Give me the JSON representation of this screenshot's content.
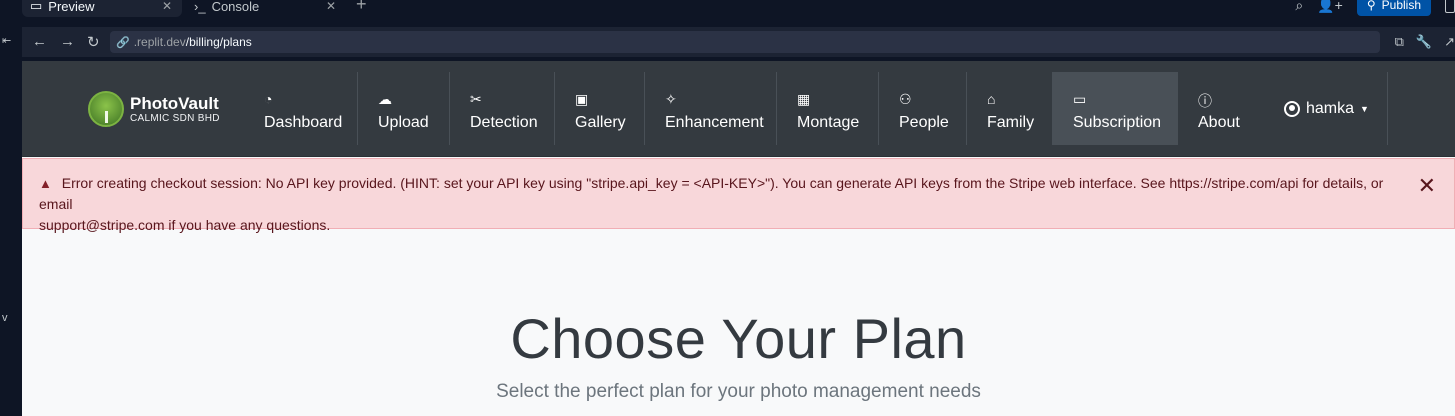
{
  "ide": {
    "tabs": [
      {
        "label": "Preview",
        "icon": "monitor-icon"
      },
      {
        "label": "Console",
        "icon": "terminal-icon"
      }
    ],
    "publish_label": "Publish"
  },
  "address": {
    "domain": ".replit.dev",
    "path": "/billing/plans"
  },
  "brand": {
    "name": "PhotoVault",
    "subtitle": "CALMIC SDN BHD"
  },
  "nav": {
    "items": [
      {
        "label": "Dashboard",
        "icon": "speedometer-icon"
      },
      {
        "label": "Upload",
        "icon": "cloud-upload-icon"
      },
      {
        "label": "Detection",
        "icon": "scissors-icon"
      },
      {
        "label": "Gallery",
        "icon": "image-icon"
      },
      {
        "label": "Enhancement",
        "icon": "magic-wand-icon"
      },
      {
        "label": "Montage",
        "icon": "grid-icon"
      },
      {
        "label": "People",
        "icon": "people-icon"
      },
      {
        "label": "Family",
        "icon": "house-heart-icon"
      },
      {
        "label": "Subscription",
        "icon": "credit-card-icon"
      },
      {
        "label": "About",
        "icon": "info-circle-icon"
      }
    ],
    "active": "Subscription",
    "user": "hamka"
  },
  "alert": {
    "line1": "Error creating checkout session: No API key provided. (HINT: set your API key using \"stripe.api_key = <API-KEY>\"). You can generate API keys from the Stripe web interface. See https://stripe.com/api for details, or email",
    "line2": "support@stripe.com if you have any questions.",
    "type": "danger"
  },
  "hero": {
    "title": "Choose Your Plan",
    "subtitle": "Select the perfect plan for your photo management needs"
  },
  "colors": {
    "navbar_bg": "#343a40",
    "active_nav_bg": "#495057",
    "alert_bg": "#f8d7da",
    "alert_text": "#58151c",
    "publish_btn": "#0053a6"
  }
}
